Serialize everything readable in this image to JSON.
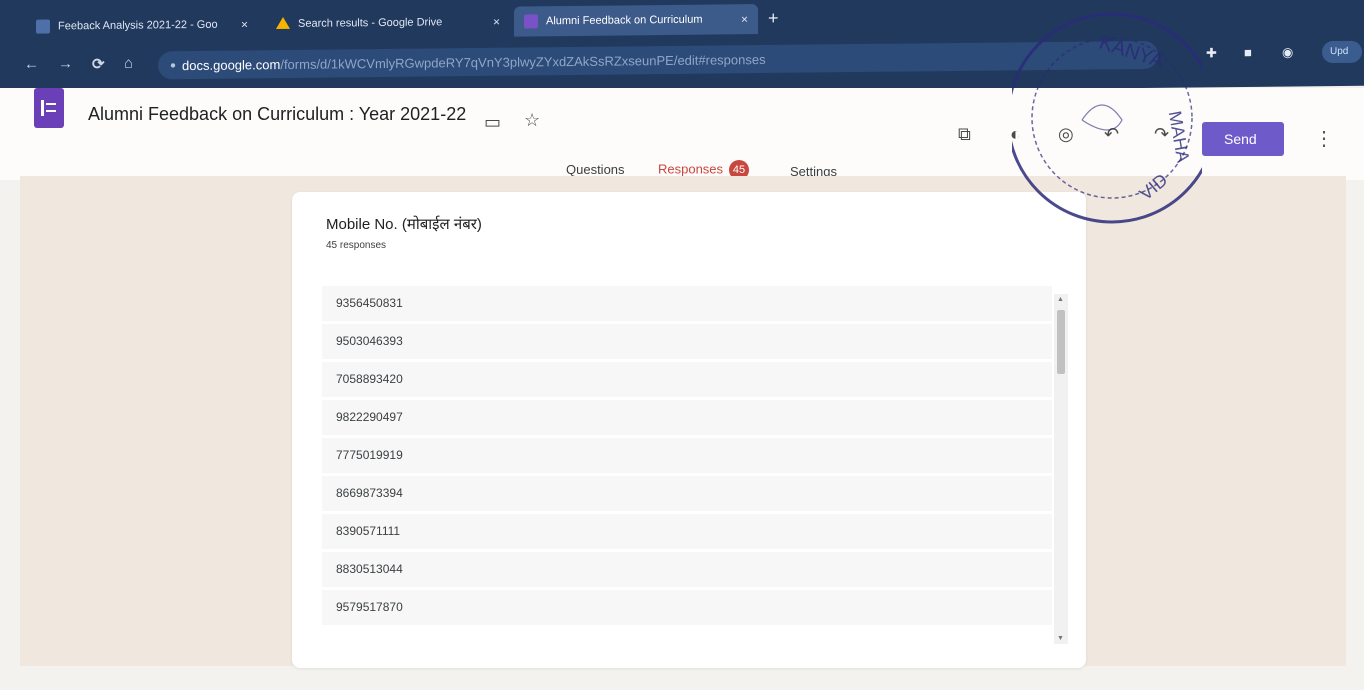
{
  "browser": {
    "tabs": [
      {
        "title": "Feeback Analysis 2021-22 - Goo",
        "favicon_color": "#4f6fa8"
      },
      {
        "title": "Search results - Google Drive",
        "favicon_color": "#f4b400"
      },
      {
        "title": "Alumni Feedback on Curriculum",
        "favicon_color": "#7a52c7",
        "active": true
      }
    ],
    "tab_close": "×",
    "new_tab": "+",
    "url_host": "docs.google.com",
    "url_path": "/forms/d/1kWCVmlyRGwpdeRY7qVnY3plwyZYxdZAkSsRZxseunPE/edit#responses",
    "update_label": "Upd"
  },
  "form": {
    "title": "Alumni Feedback on Curriculum  : Year 2021-22",
    "send_label": "Send",
    "tabs": {
      "questions": "Questions",
      "responses": "Responses",
      "responses_count": "45",
      "settings": "Settings"
    }
  },
  "question": {
    "title": "Mobile No. (मोबाईल नंबर)",
    "response_count": "45 responses",
    "responses": [
      "9356450831",
      "9503046393",
      "7058893420",
      "9822290497",
      "7775019919",
      "8669873394",
      "8390571111",
      "8830513044",
      "9579517870"
    ]
  },
  "stamp": {
    "text": "KANYA MAHAVID",
    "color": "#2a2a7a"
  },
  "colors": {
    "accent": "#6f5ac9",
    "responses_tab": "#c8473f",
    "chrome_bg": "#21395d"
  }
}
